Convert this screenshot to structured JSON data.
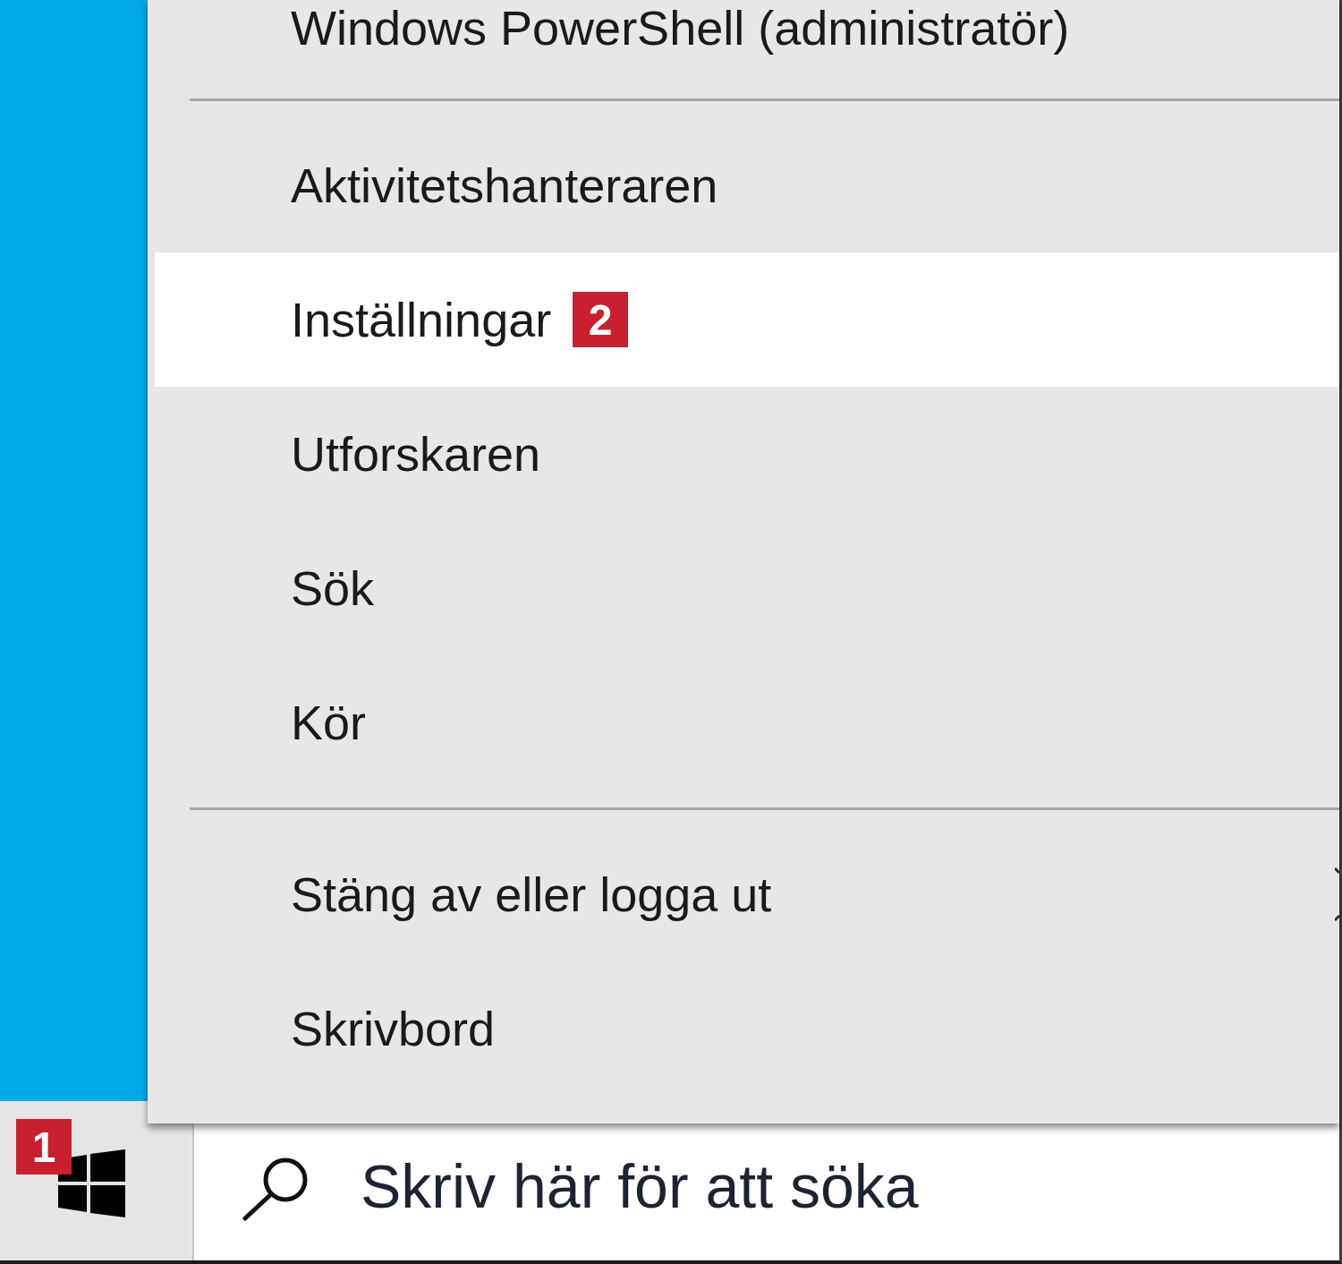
{
  "start_menu": {
    "groups": [
      {
        "items": [
          {
            "label": "Windows PowerShell (administratör)",
            "selected": false,
            "submenu": false
          }
        ]
      },
      {
        "items": [
          {
            "label": "Aktivitetshanteraren",
            "selected": false,
            "submenu": false
          },
          {
            "label": "Inställningar",
            "selected": true,
            "submenu": false,
            "badge": "2"
          },
          {
            "label": "Utforskaren",
            "selected": false,
            "submenu": false
          },
          {
            "label": "Sök",
            "selected": false,
            "submenu": false
          },
          {
            "label": "Kör",
            "selected": false,
            "submenu": false
          }
        ]
      },
      {
        "items": [
          {
            "label": "Stäng av eller logga ut",
            "selected": false,
            "submenu": true
          },
          {
            "label": "Skrivbord",
            "selected": false,
            "submenu": false
          }
        ]
      }
    ]
  },
  "taskbar": {
    "start_button": {
      "badge": "1"
    },
    "search": {
      "placeholder": "Skriv här för att söka"
    }
  }
}
